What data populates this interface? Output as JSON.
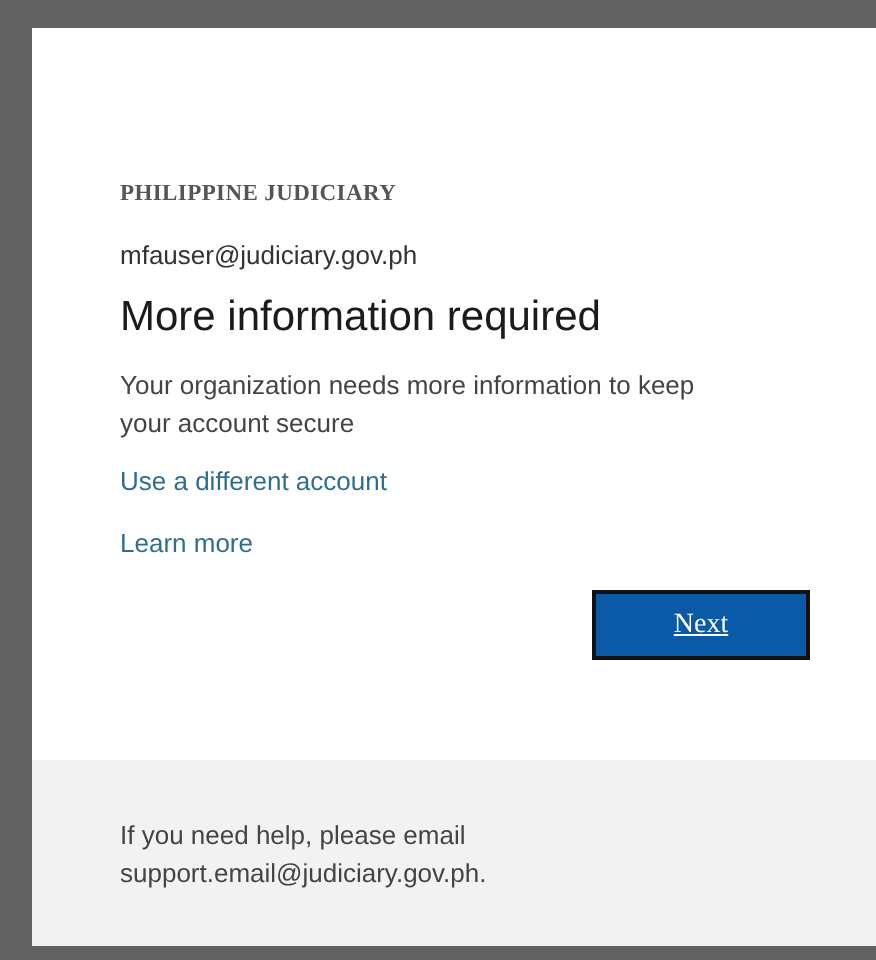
{
  "organization": "PHILIPPINE JUDICIARY",
  "account": "mfauser@judiciary.gov.ph",
  "title": "More information required",
  "description": "Your organization needs more information to keep your account secure",
  "links": [
    "Use a different account",
    "Learn more"
  ],
  "button": "Next",
  "footer": "If you need help, please email support.email@judiciary.gov.ph."
}
